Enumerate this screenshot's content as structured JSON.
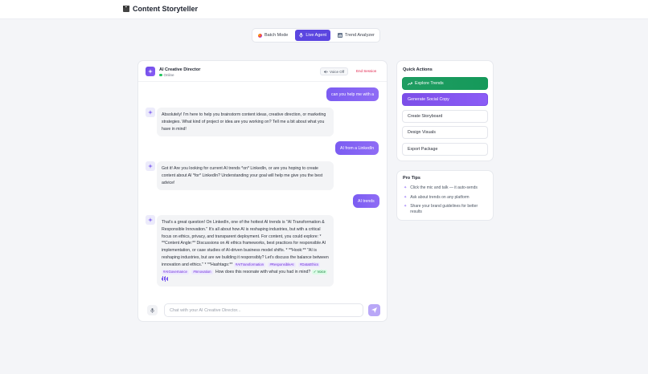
{
  "app": {
    "title": "Content Storyteller"
  },
  "modes": [
    {
      "label": "Batch Mode",
      "icon": "palette-icon",
      "active": false
    },
    {
      "label": "Live Agent",
      "icon": "microphone-icon",
      "active": true
    },
    {
      "label": "Trend Analyzer",
      "icon": "bar-chart-icon",
      "active": false
    }
  ],
  "chat": {
    "agent_name": "AI Creative Director",
    "status": "Online",
    "voice_label": "Voice Off",
    "end_label": "End Session",
    "messages": [
      {
        "role": "user",
        "text": "can you help me with a"
      },
      {
        "role": "bot",
        "text": "Absolutely! I'm here to help you brainstorm content ideas, creative direction, or marketing strategies. What kind of project or idea are you working on? Tell me a bit about what you have in mind!"
      },
      {
        "role": "user",
        "text": "AI from a LinkedIn"
      },
      {
        "role": "bot",
        "text": "Got it! Are you looking for current AI trends *on* LinkedIn, or are you hoping to create content about AI *for* LinkedIn? Understanding your goal will help me give you the best advice!"
      },
      {
        "role": "user",
        "text": "AI trends"
      },
      {
        "role": "bot",
        "text": "That's a great question! On LinkedIn, one of the hottest AI trends is \"AI Transformation & Responsible Innovation.\" It's all about how AI is reshaping industries, but with a critical focus on ethics, privacy, and transparent deployment. For content, you could explore: * **Content Angle:** Discussions on AI ethics frameworks, best practices for responsible AI implementation, or case studies of AI-driven business model shifts. * **Hook:** \"AI is reshaping industries, but are we building it responsibly? Let's discuss the balance between innovation and ethics.\" * **Hashtags:**"
      }
    ],
    "hashtags": [
      "#AITransformation",
      "#ResponsibleAI",
      "#DataEthics",
      "#AIGovernance",
      "#Innovation"
    ],
    "closing_text": "How does this resonate with what you had in mind?",
    "voice_badge": "✓ Voice",
    "input_placeholder": "Chat with your AI Creative Director..."
  },
  "quick_actions": {
    "title": "Quick Actions",
    "items": [
      {
        "label": "Explore Trends",
        "style": "green",
        "icon": "trending-up-icon"
      },
      {
        "label": "Generate Social Copy",
        "style": "purple"
      },
      {
        "label": "Create Storyboard",
        "style": "plain"
      },
      {
        "label": "Design Visuals",
        "style": "plain"
      },
      {
        "label": "Export Package",
        "style": "plain"
      }
    ]
  },
  "pro_tips": {
    "title": "Pro Tips",
    "items": [
      "Click the mic and talk — it auto-sends",
      "Ask about trends on any platform",
      "Share your brand guidelines for better results"
    ]
  },
  "colors": {
    "accent": "#5b46e0",
    "user_bubble": "#7b5cf2",
    "green": "#1f9d62",
    "danger": "#e11d48"
  }
}
